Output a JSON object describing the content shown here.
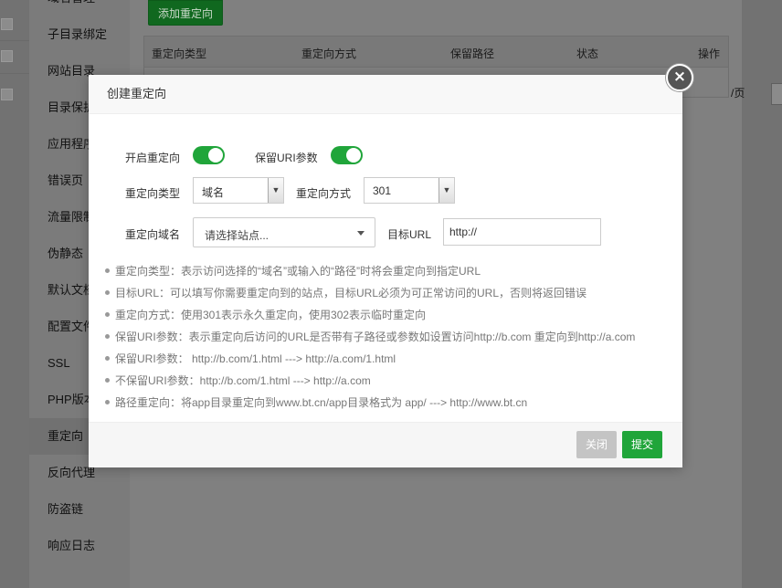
{
  "background": {
    "sidebar_items": [
      "域名管理",
      "子目录绑定",
      "网站目录",
      "目录保护",
      "应用程序",
      "错误页",
      "流量限制",
      "伪静态",
      "默认文档",
      "配置文件",
      "SSL",
      "PHP版本",
      "重定向",
      "反向代理",
      "防盗链",
      "响应日志"
    ],
    "active_sidebar_item": "重定向",
    "add_button_label": "添加重定向",
    "table_headers": [
      "重定向类型",
      "重定向方式",
      "保留路径",
      "状态",
      "操作"
    ],
    "page_size_suffix": "/页"
  },
  "modal": {
    "title": "创建重定向",
    "close_icon": "×",
    "enable_redirect_label": "开启重定向",
    "enable_redirect_on": true,
    "keep_uri_label": "保留URI参数",
    "keep_uri_on": true,
    "redirect_type_label": "重定向类型",
    "redirect_type_value": "域名",
    "redirect_method_label": "重定向方式",
    "redirect_method_value": "301",
    "redirect_domain_label": "重定向域名",
    "redirect_domain_placeholder": "请选择站点...",
    "target_url_label": "目标URL",
    "target_url_value": "http://",
    "tips": [
      "重定向类型：表示访问选择的“域名”或输入的“路径”时将会重定向到指定URL",
      "目标URL：可以填写你需要重定向到的站点，目标URL必须为可正常访问的URL，否则将返回错误",
      "重定向方式：使用301表示永久重定向，使用302表示临时重定向",
      "保留URI参数：表示重定向后访问的URL是否带有子路径或参数如设置访问http://b.com 重定向到http://a.com",
      "保留URI参数： http://b.com/1.html ---> http://a.com/1.html",
      "不保留URI参数：http://b.com/1.html ---> http://a.com",
      "路径重定向：将app目录重定向到www.bt.cn/app目录格式为 app/ ---> http://www.bt.cn"
    ],
    "close_button_label": "关闭",
    "submit_button_label": "提交"
  },
  "colors": {
    "accent_green": "#20a53a",
    "disabled_gray": "#c4c4c4"
  }
}
